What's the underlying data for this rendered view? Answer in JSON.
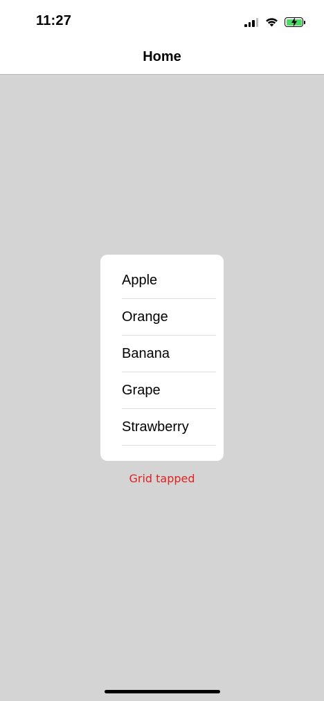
{
  "status_bar": {
    "time": "11:27",
    "signal_bars": 4,
    "signal_active_bars": 3,
    "battery_level": 1.0,
    "battery_charging": true,
    "battery_color": "#4cd964"
  },
  "nav": {
    "title": "Home"
  },
  "list": {
    "items": [
      {
        "label": "Apple"
      },
      {
        "label": "Orange"
      },
      {
        "label": "Banana"
      },
      {
        "label": "Grape"
      },
      {
        "label": "Strawberry"
      }
    ]
  },
  "status_message": {
    "text": "Grid tapped",
    "color": "#e02020"
  },
  "colors": {
    "background": "#d4d4d4",
    "card": "#ffffff"
  }
}
